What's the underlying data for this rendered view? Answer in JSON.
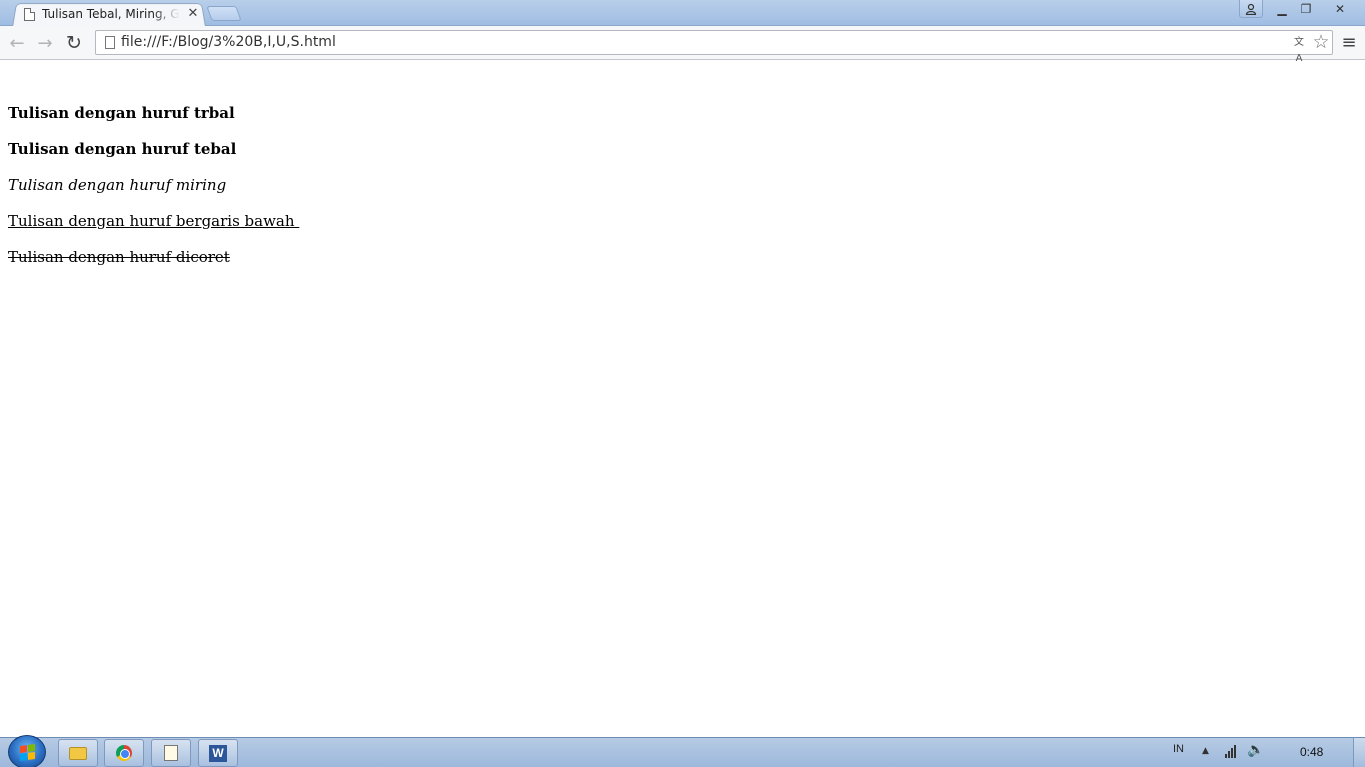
{
  "browser": {
    "tab": {
      "title": "Tulisan Tebal, Miring, Garis Bawah, Coret",
      "close_glyph": "✕",
      "icon": "page-icon"
    },
    "new_tab_icon": "new-tab-icon",
    "window_controls": {
      "profile_icon": "profile-icon",
      "minimize_glyph": "▁",
      "maximize_glyph": "❐",
      "close_glyph": "✕"
    },
    "toolbar": {
      "back_glyph": "←",
      "forward_glyph": "→",
      "reload_glyph": "↻",
      "url": "file:///F:/Blog/3%20B,I,U,S.html",
      "translate_glyph": "文A",
      "star_glyph": "☆",
      "menu_glyph": "≡"
    }
  },
  "page": {
    "lines": [
      {
        "text": "Tulisan dengan huruf trbal",
        "style": "bold"
      },
      {
        "text": "Tulisan dengan huruf tebal",
        "style": "bold"
      },
      {
        "text": "Tulisan dengan huruf miring",
        "style": "italic"
      },
      {
        "text": "Tulisan dengan huruf bergaris bawah ",
        "style": "underline"
      },
      {
        "text": "Tulisan dengan huruf dicoret",
        "style": "strikethrough"
      }
    ]
  },
  "taskbar": {
    "start_icon": "windows-start-icon",
    "pinned": [
      {
        "name": "windows-explorer-icon"
      },
      {
        "name": "chrome-icon"
      },
      {
        "name": "notepad-icon"
      },
      {
        "name": "word-icon",
        "glyph": "W"
      }
    ],
    "tray": {
      "language": "IN",
      "show_hidden_glyph": "▲",
      "volume_glyph": "🔈",
      "clock": "0:48"
    }
  },
  "colors": {
    "titlebar": "#a9c4e6",
    "taskbar": "#a8c0e0",
    "page_background": "#ffffff",
    "text": "#000000"
  }
}
